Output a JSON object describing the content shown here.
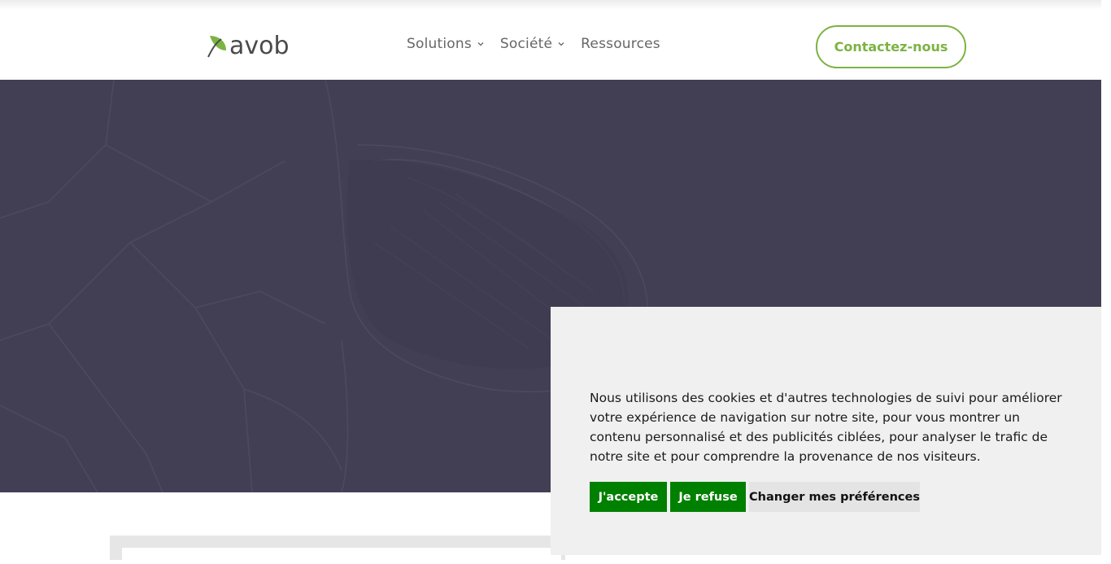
{
  "header": {
    "logo_text": "avob",
    "nav": [
      {
        "label": "Solutions",
        "has_dropdown": true
      },
      {
        "label": "Société",
        "has_dropdown": true
      },
      {
        "label": "Ressources",
        "has_dropdown": false
      }
    ],
    "contact_label": "Contactez-nous"
  },
  "colors": {
    "accent": "#7cb342",
    "hero_overlay": "#423f55",
    "cookie_button": "#008000",
    "cookie_background": "#f0f0f0"
  },
  "cookie_banner": {
    "text": "Nous utilisons des cookies et d'autres technologies de suivi pour améliorer votre expérience de navigation sur notre site, pour vous montrer un contenu personnalisé et des publicités ciblées, pour analyser le trafic de notre site et pour comprendre la provenance de nos visiteurs.",
    "accept_label": "J'accepte",
    "refuse_label": "Je refuse",
    "preferences_label": "Changer mes préférences"
  },
  "icons": [
    "leaf-logo-icon",
    "chevron-down-icon"
  ]
}
